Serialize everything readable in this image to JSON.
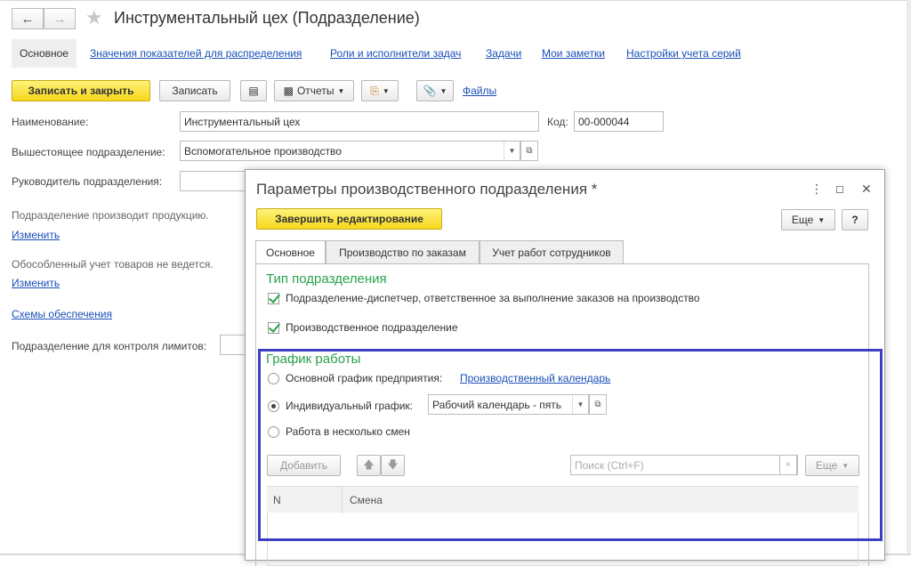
{
  "window": {
    "title": "Инструментальный цех (Подразделение)"
  },
  "tabs": {
    "active": "Основное",
    "links": [
      "Значения показателей для распределения",
      "Роли и исполнители задач",
      "Задачи",
      "Мои заметки",
      "Настройки учета серий"
    ]
  },
  "toolbar": {
    "save_close": "Записать и закрыть",
    "save": "Записать",
    "reports": "Отчеты",
    "files": "Файлы"
  },
  "form": {
    "name_label": "Наименование:",
    "name_value": "Инструментальный цех",
    "code_label": "Код:",
    "code_value": "00-000044",
    "parent_label": "Вышестоящее подразделение:",
    "parent_value": "Вспомогательное производство",
    "head_label": "Руководитель подразделения:",
    "produces_text": "Подразделение производит продукцию.",
    "change_link_1": "Изменить",
    "separate_text": "Обособленный учет товаров не ведется.",
    "change_link_2": "Изменить",
    "schemes_link": "Схемы обеспечения",
    "limits_label": "Подразделение для контроля лимитов:"
  },
  "dialog": {
    "title": "Параметры производственного подразделения *",
    "finish_button": "Завершить редактирование",
    "more_button": "Еще",
    "help_button": "?",
    "tabs": [
      "Основное",
      "Производство по заказам",
      "Учет работ сотрудников"
    ],
    "type_section": "Тип подразделения",
    "dispatcher_checkbox": "Подразделение-диспетчер, ответственное за выполнение заказов на производство",
    "production_checkbox": "Производственное подразделение",
    "schedule_section": "График работы",
    "main_schedule_radio": "Основной график предприятия:",
    "production_calendar_link": "Производственный календарь",
    "individual_radio": "Индивидуальный график:",
    "individual_value": "Рабочий календарь - пять",
    "shifts_radio": "Работа в несколько смен",
    "add_button": "Добавить",
    "search_placeholder": "Поиск (Ctrl+F)",
    "more_button_2": "Еще",
    "col_n": "N",
    "col_shift": "Смена"
  },
  "colors": {
    "accent_yellow": "#f5d71c",
    "link_blue": "#1a4fb7",
    "section_green": "#2aa24b",
    "highlight_frame": "#3b40c2"
  }
}
